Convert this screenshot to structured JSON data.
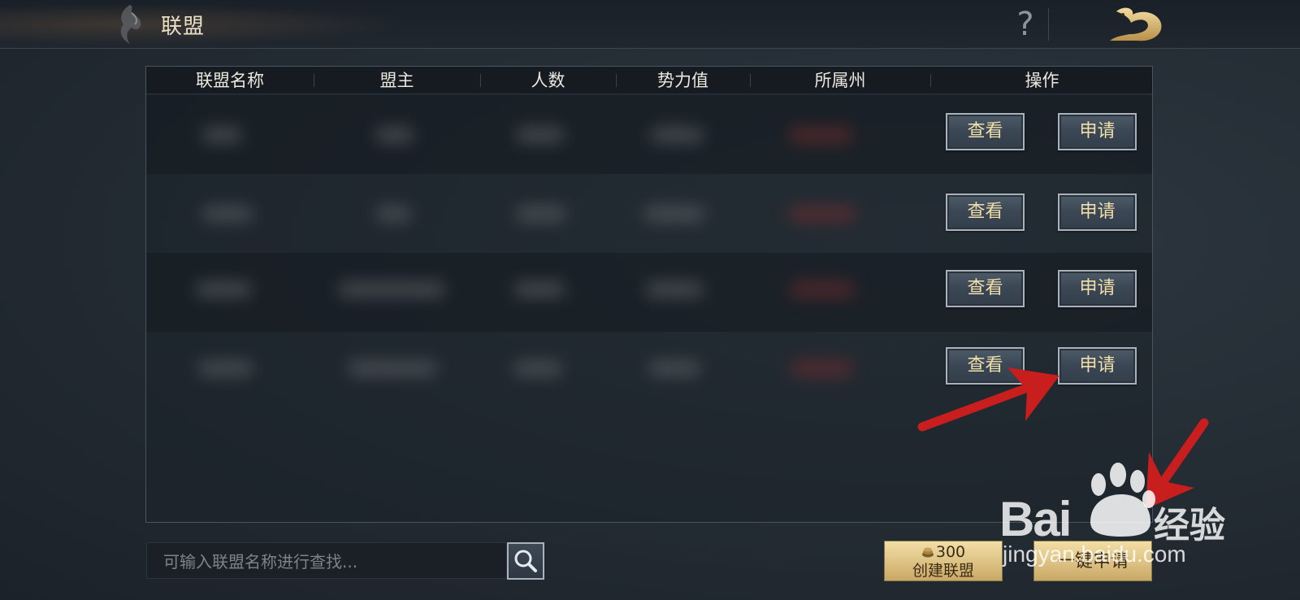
{
  "header": {
    "title": "联盟",
    "help_label": "?"
  },
  "table": {
    "columns": [
      "联盟名称",
      "盟主",
      "人数",
      "势力值",
      "所属州",
      "操作"
    ],
    "rows": [
      {
        "view_label": "查看",
        "apply_label": "申请"
      },
      {
        "view_label": "查看",
        "apply_label": "申请"
      },
      {
        "view_label": "查看",
        "apply_label": "申请"
      },
      {
        "view_label": "查看",
        "apply_label": "申请"
      }
    ]
  },
  "search": {
    "placeholder": "可输入联盟名称进行查找..."
  },
  "actions": {
    "create_cost": "300",
    "create_label": "创建联盟",
    "quick_apply_label": "一键申请"
  },
  "watermark": {
    "brand_left": "Bai",
    "brand_right": "经验",
    "url": "jingyan.baidu.com"
  },
  "icons": [
    "emblem-icon",
    "help-icon",
    "back-icon",
    "search-icon",
    "coin-icon",
    "baidu-paw-icon"
  ],
  "colors": {
    "button_text": "#f0dfa8",
    "gold_button": "#ddc183",
    "annotation_arrow": "#c81e1e"
  }
}
